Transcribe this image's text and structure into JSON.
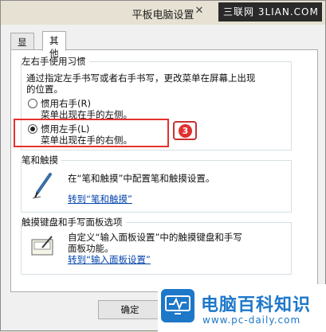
{
  "window": {
    "title": "平板电脑设置",
    "close_glyph": "✕"
  },
  "corner_watermark": "三联网 3LIAN.COM",
  "tabs": [
    {
      "label": "显示",
      "active": false
    },
    {
      "label": "其他",
      "active": true
    }
  ],
  "handedness": {
    "title": "左右手使用习惯",
    "description_line1": "通过指定左手书写或者右手书写，更改菜单在屏幕上出现",
    "description_line2": "的位置。",
    "options": [
      {
        "label": "惯用右手(R)",
        "desc": "菜单出现在手的左侧。",
        "selected": false
      },
      {
        "label": "惯用左手(L)",
        "desc": "菜单出现在手的右侧。",
        "selected": true
      }
    ],
    "callout_number": "3"
  },
  "pen": {
    "title": "笔和触摸",
    "text": "在“笔和触摸”中配置笔和触摸设置。",
    "link": "转到“笔和触摸”"
  },
  "touch_keyboard": {
    "title": "触摸键盘和手写面板选项",
    "text_line1": "自定义“输入面板设置”中的触摸键盘和手写",
    "text_line2": "面板功能。",
    "link": "转到“输入面板设置”"
  },
  "buttons": {
    "ok": "确定"
  },
  "watermark": {
    "name": "电脑百科知识",
    "url": "www.pc-daily.com"
  },
  "colors": {
    "accent_red": "#e53030",
    "link_blue": "#0645ad",
    "brand_blue": "#1e78c8"
  }
}
